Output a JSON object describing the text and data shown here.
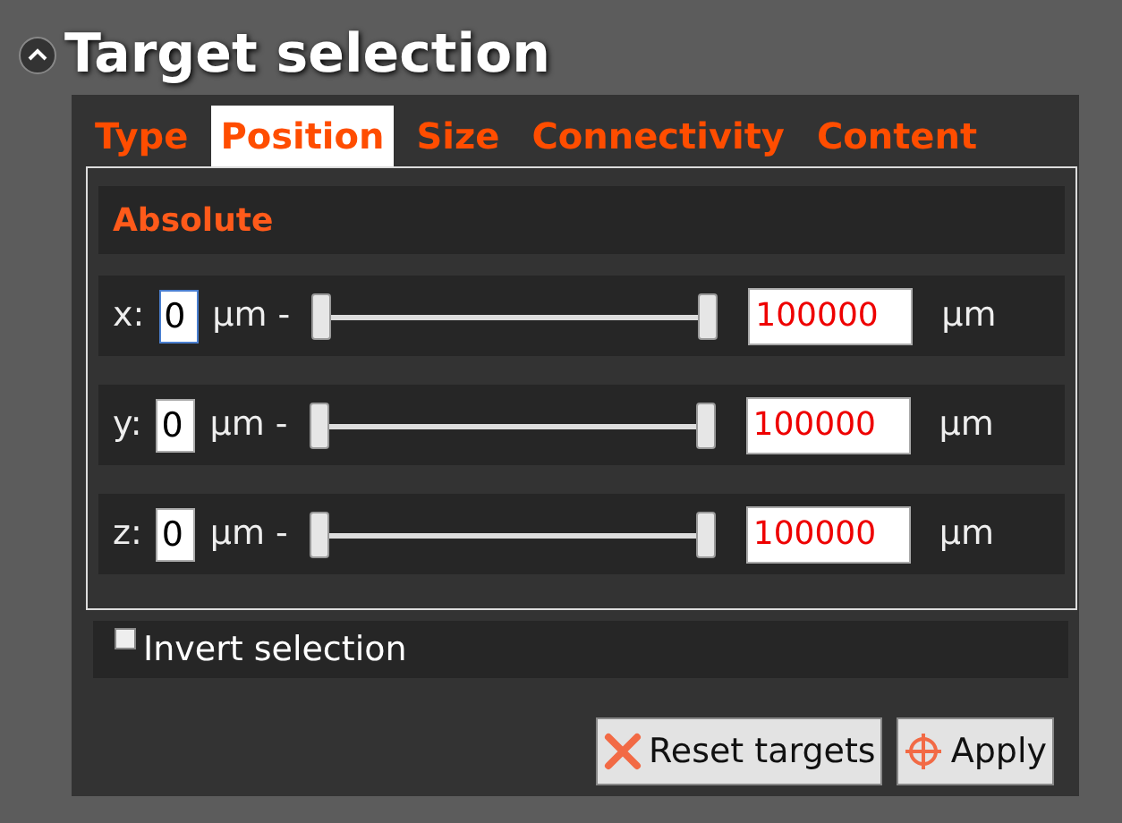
{
  "panel": {
    "title": "Target selection",
    "expanded": true
  },
  "tabs": [
    {
      "label": "Type",
      "selected": false
    },
    {
      "label": "Position",
      "selected": true
    },
    {
      "label": "Size",
      "selected": false
    },
    {
      "label": "Connectivity",
      "selected": false
    },
    {
      "label": "Content",
      "selected": false
    }
  ],
  "section": {
    "title": "Absolute"
  },
  "ranges": [
    {
      "axis": "x:",
      "min_value": "0",
      "unit_min": "µm -",
      "handles": [
        {
          "level": 0
        },
        {
          "level": 1
        }
      ],
      "max_value": "100000",
      "unit_max": "µm"
    },
    {
      "axis": "y:",
      "min_value": "0",
      "unit_min": "µm -",
      "handles": [
        {
          "level": 0
        },
        {
          "level": 1
        }
      ],
      "max_value": "100000",
      "unit_max": "µm"
    },
    {
      "axis": "z:",
      "min_value": "0",
      "unit_min": "µm -",
      "handles": [
        {
          "level": 0
        },
        {
          "level": 1
        }
      ],
      "max_value": "100000",
      "unit_max": "µm"
    }
  ],
  "invert": {
    "label": "Invert selection",
    "checked": false
  },
  "buttons": [
    {
      "kind": "reset",
      "label": "Reset targets"
    },
    {
      "kind": "apply",
      "label": "Apply"
    }
  ]
}
